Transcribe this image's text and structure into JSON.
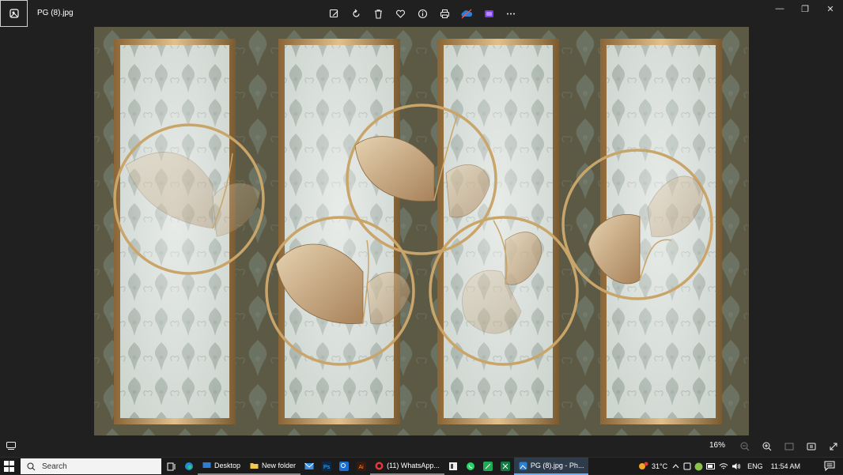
{
  "window": {
    "filename": "PG (8).jpg",
    "toolbar_icons": [
      "edit-image-icon",
      "rotate-icon",
      "delete-icon",
      "favorite-icon",
      "info-icon",
      "print-icon",
      "onedrive-icon",
      "clipchamp-icon",
      "more-icon"
    ],
    "controls": {
      "minimize": "—",
      "maximize": "❐",
      "close": "✕"
    }
  },
  "viewer": {
    "zoom_label": "16%",
    "bottom_icons": [
      "zoom-out-icon",
      "zoom-in-icon",
      "fit-to-window-icon",
      "slideshow-icon",
      "fullscreen-icon"
    ]
  },
  "image": {
    "colors": {
      "wall": "#5c5a44",
      "panel": "#cfd7d1",
      "frame_gold": "#b48a55",
      "leaf_gold": "#c8a87a"
    }
  },
  "taskbar": {
    "search_placeholder": "Search",
    "apps": [
      {
        "label": "Desktop",
        "state": "open"
      },
      {
        "label": "New folder",
        "state": "open"
      },
      {
        "label": "(11) WhatsApp...",
        "state": "open"
      },
      {
        "label": "PG (8).jpg - Ph...",
        "state": "active"
      }
    ],
    "weather_temp": "31°C",
    "language": "ENG",
    "time": "11:54 AM"
  }
}
